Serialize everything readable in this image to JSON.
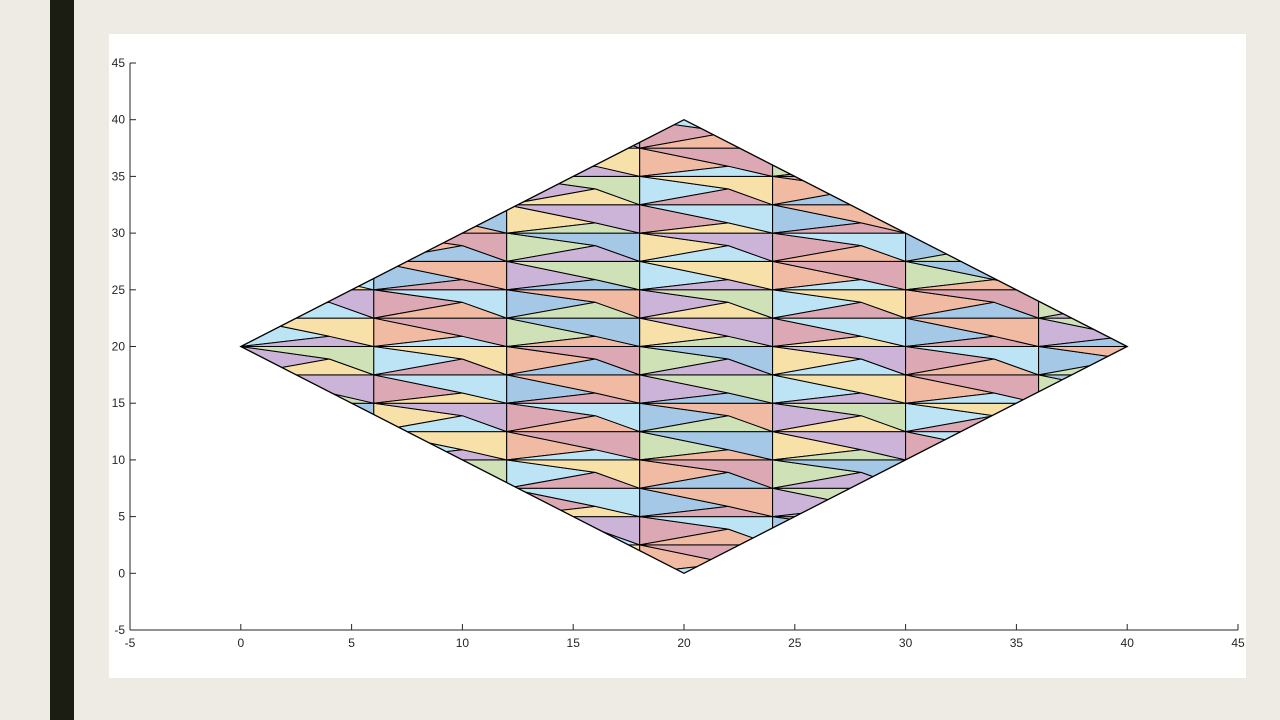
{
  "chart_data": {
    "type": "tiling",
    "title": "",
    "xlabel": "",
    "ylabel": "",
    "xlim": [
      -5,
      45
    ],
    "ylim": [
      -5,
      45
    ],
    "xticks": [
      -5,
      0,
      5,
      10,
      15,
      20,
      25,
      30,
      35,
      40,
      45
    ],
    "yticks": [
      -5,
      0,
      5,
      10,
      15,
      20,
      25,
      30,
      35,
      40,
      45
    ],
    "grid": false,
    "region": {
      "shape": "rhombus",
      "vertices": [
        [
          0,
          20
        ],
        [
          20,
          0
        ],
        [
          40,
          20
        ],
        [
          20,
          40
        ]
      ]
    },
    "tile": {
      "width": 6,
      "height": 5,
      "tooth_length": 4
    },
    "palette": [
      "#a4c8e6",
      "#f8e1a8",
      "#f1baa2",
      "#ccb3d8",
      "#dca8b3",
      "#cfe1b6",
      "#bde4f5"
    ],
    "outline_color": "#000000"
  }
}
